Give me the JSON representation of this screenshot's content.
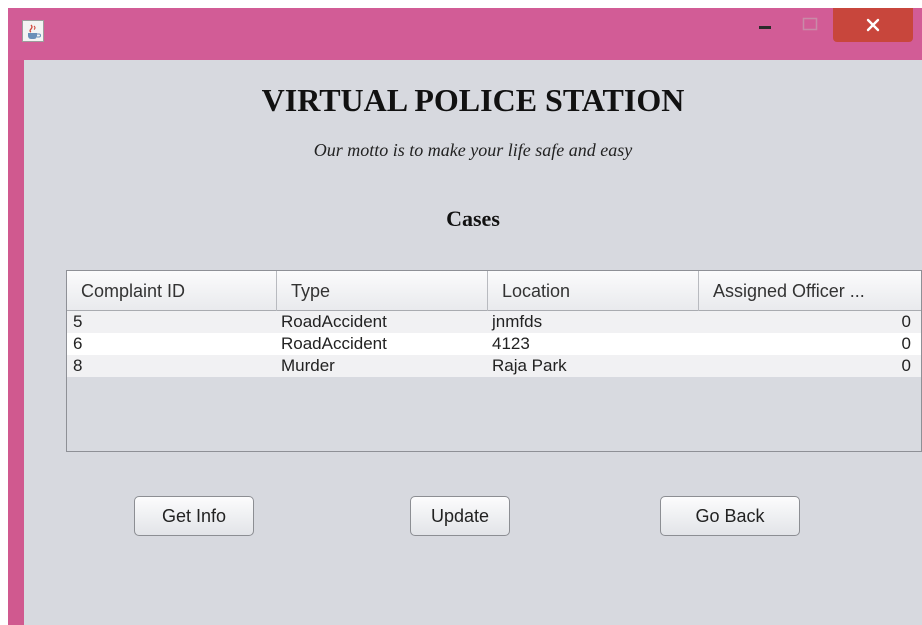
{
  "window": {
    "icons": {
      "app": "java-cup-icon",
      "minimize": "minimize-icon",
      "maximize": "maximize-icon",
      "close": "close-icon"
    },
    "colors": {
      "titlebar": "#d25c96",
      "close": "#c8463c",
      "client": "#d7d9df"
    }
  },
  "header": {
    "title": "VIRTUAL POLICE STATION",
    "motto": "Our motto is to make your life safe and easy"
  },
  "section": {
    "heading": "Cases"
  },
  "table": {
    "columns": [
      "Complaint ID",
      "Type",
      "Location",
      "Assigned Officer ..."
    ],
    "rows": [
      [
        "5",
        "RoadAccident",
        "jnmfds",
        "0"
      ],
      [
        "6",
        "RoadAccident",
        "4123",
        "0"
      ],
      [
        "8",
        "Murder",
        "Raja Park",
        "0"
      ]
    ]
  },
  "buttons": {
    "get_info": "Get Info",
    "update": "Update",
    "go_back": "Go Back"
  }
}
